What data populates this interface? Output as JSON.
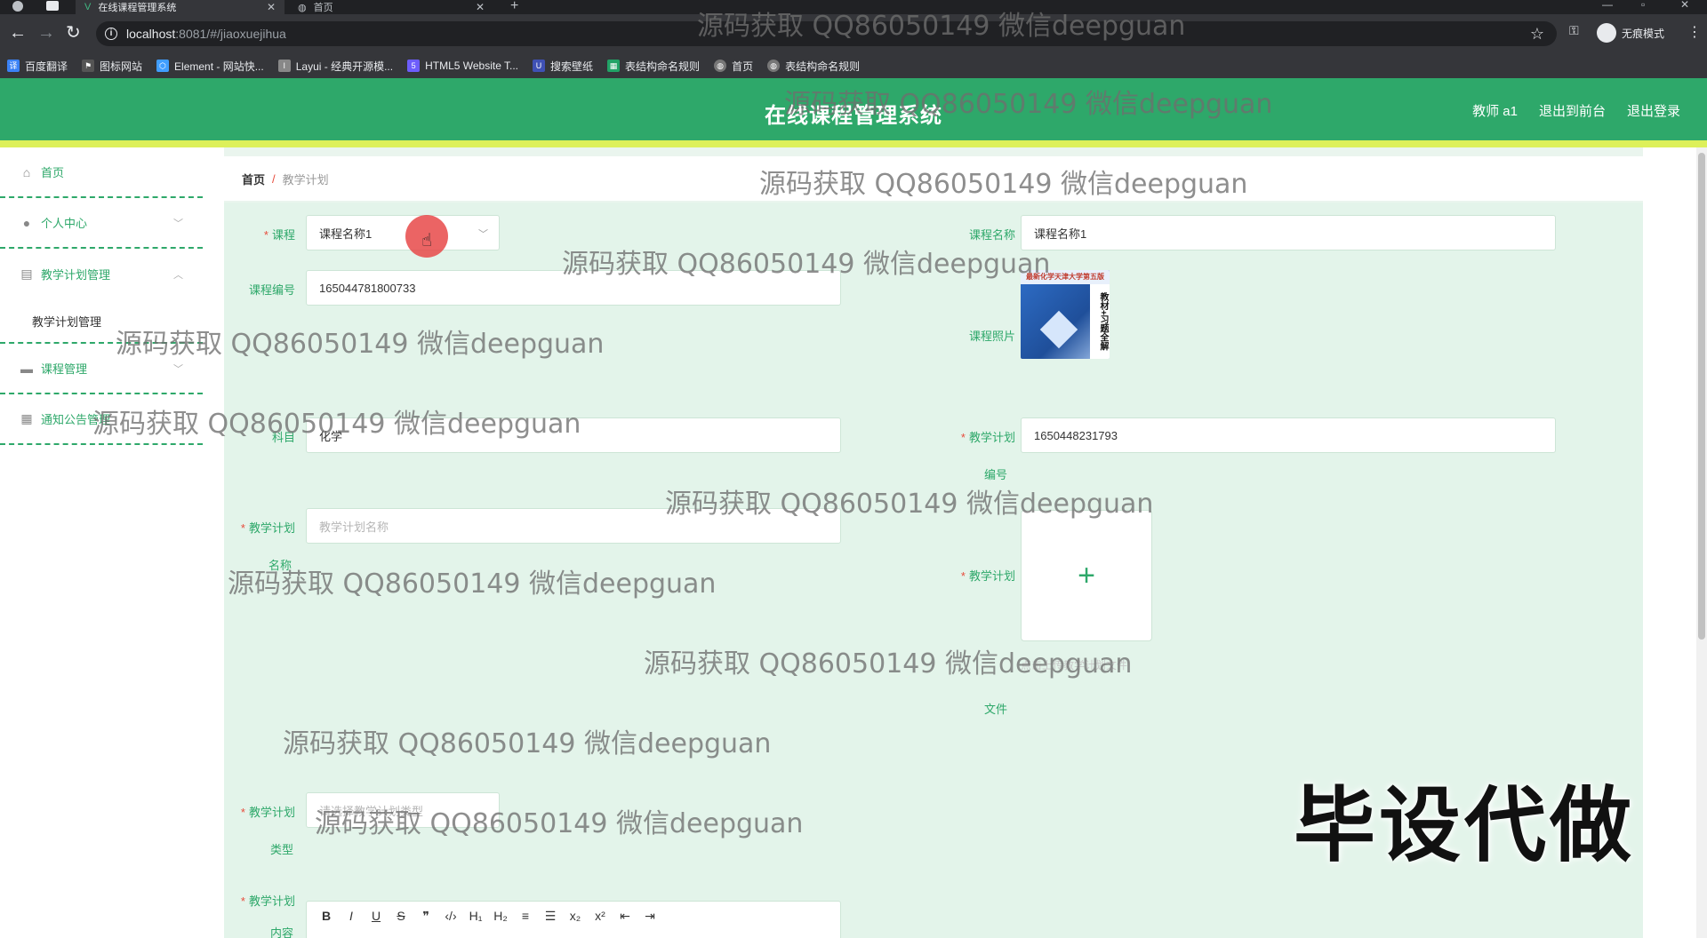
{
  "browser": {
    "tabs": [
      {
        "title": "在线课程管理系统",
        "active": true
      },
      {
        "title": "首页",
        "active": false
      }
    ],
    "url_host": "localhost",
    "url_path": ":8081/#/jiaoxuejihua",
    "incognito_label": "无痕模式",
    "bookmarks": [
      {
        "label": "百度翻译",
        "color": "#3b82f6"
      },
      {
        "label": "图标网站",
        "color": "#555555"
      },
      {
        "label": "Element - 网站快...",
        "color": "#409eff"
      },
      {
        "label": "Layui - 经典开源模...",
        "color": "#888888"
      },
      {
        "label": "HTML5 Website T...",
        "color": "#6d5dfc"
      },
      {
        "label": "搜索壁纸",
        "color": "#3f51b5"
      },
      {
        "label": "表结构命名规则",
        "color": "#21a366"
      },
      {
        "label": "首页",
        "color": "#777777"
      },
      {
        "label": "表结构命名规则",
        "color": "#777777"
      }
    ]
  },
  "header": {
    "title": "在线课程管理系统",
    "user": "教师 a1",
    "to_front": "退出到前台",
    "logout": "退出登录"
  },
  "sidebar": {
    "items": [
      {
        "label": "首页"
      },
      {
        "label": "个人中心"
      },
      {
        "label": "教学计划管理"
      },
      {
        "label": "教学计划管理"
      },
      {
        "label": "课程管理"
      },
      {
        "label": "通知公告管理"
      }
    ]
  },
  "breadcrumb": {
    "home": "首页",
    "sep": "/",
    "current": "教学计划"
  },
  "form": {
    "course_label": "课程",
    "course_value": "课程名称1",
    "course_name_label": "课程名称",
    "course_name_value": "课程名称1",
    "course_no_label": "课程编号",
    "course_no_value": "165044781800733",
    "course_photo_label": "课程照片",
    "book_top": "最新化学天津大学第五版",
    "book_side": "教材+习题全解",
    "subject_label": "科目",
    "subject_value": "化学",
    "plan_no_label_1": "教学计划",
    "plan_no_label_2": "编号",
    "plan_no_value": "1650448231793",
    "plan_name_label_1": "教学计划",
    "plan_name_label_2": "名称",
    "plan_name_placeholder": "教学计划名称",
    "plan_file_label_1": "教学计划",
    "plan_file_label_2": "文件",
    "upload_symbol": "+",
    "upload_hint": "点击上传教学计划文件",
    "plan_type_label_1": "教学计划",
    "plan_type_label_2": "类型",
    "plan_type_placeholder": "请选择教学计划类型",
    "plan_content_label_1": "教学计划",
    "plan_content_label_2": "内容",
    "editor_toolbar": [
      "B",
      "I",
      "U",
      "S",
      "❞",
      "‹/›",
      "H₁",
      "H₂",
      "≡",
      "☰",
      "x₂",
      "x²",
      "⇤",
      "⇥"
    ]
  },
  "watermark": "源码获取 QQ86050149 微信deepguan",
  "overlay_text": "毕设代做"
}
